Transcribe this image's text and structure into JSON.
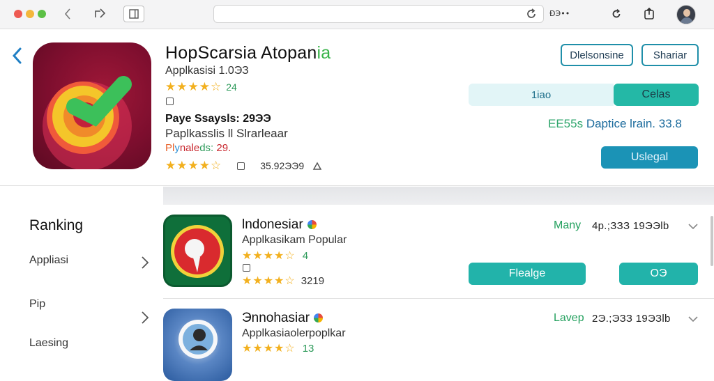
{
  "browser": {
    "url_text": "ÐЭ••",
    "icons": [
      "back-icon",
      "forward-icon",
      "sidebar-icon",
      "reload-icon",
      "share-icon"
    ]
  },
  "hero": {
    "title_main": "HopScarsia Atopan",
    "title_accent": "ia",
    "subtitle": "Applkasisi 1.0ЭЗ",
    "rating_stars": "★★★★☆",
    "rating_value": "24",
    "line2": "Paye Ssaysls: 29ЭЭ",
    "line3": "Paplkasslis ll Slrarleaar",
    "line4_parts": [
      "Pl",
      "y",
      "nale",
      "ds:",
      " 29."
    ],
    "stats_stars": "★★★★☆",
    "stats_size": "35.92ЭЭ9",
    "btn_description": "Dlelsonsine",
    "btn_share": "Shariar",
    "pill_text": "1iao",
    "btn_celas": "Celas",
    "meta_prefix": "ΕΕ55s",
    "meta_text": " Daptice lrain. 33.8",
    "btn_usage": "Uslegal"
  },
  "sidebar": {
    "heading": "Ranking",
    "items": [
      {
        "label": "Appliasi"
      },
      {
        "label": "Pip"
      },
      {
        "label": "Laesing"
      }
    ]
  },
  "rows": [
    {
      "title": "lndonesiar",
      "subtitle": "Applkasikam Popular",
      "stars_top": "★★★★☆",
      "rating_top": "4",
      "stars_bottom": "★★★★☆",
      "rating_bottom": "3219",
      "status": "Many",
      "stat": "4p.;ЗЗЗ  19ЭЭlb",
      "btn_primary": "Flealge",
      "btn_secondary": "OЭ"
    },
    {
      "title": "Эnnohasiar",
      "subtitle": "Applkasiaolerpoplkar",
      "stars_top": "★★★★☆",
      "rating_top": "13",
      "status": "Lavep",
      "stat": "2Э.;ЭЗЗ  19ЭЗlb"
    }
  ],
  "colors": {
    "accent_teal": "#22b3aa",
    "accent_blue": "#1b93b6",
    "star": "#f2b01e",
    "status_green": "#23a05e"
  }
}
